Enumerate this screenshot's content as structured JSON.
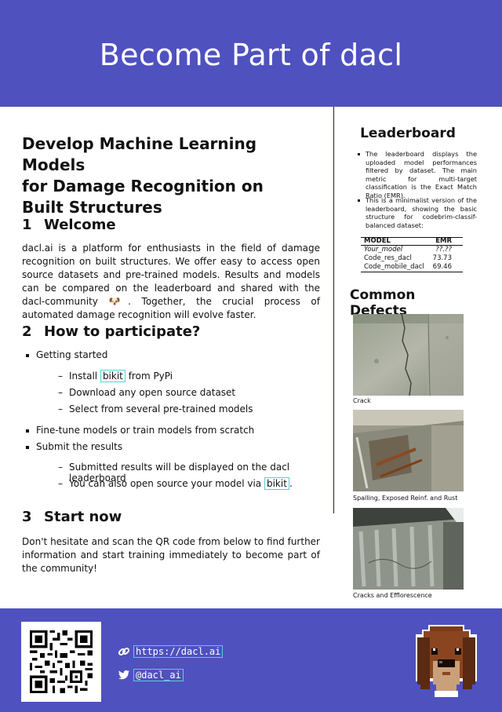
{
  "header": {
    "title": "Become Part of dacl"
  },
  "main": {
    "subtitle_lines": [
      "Develop Machine Learning Models",
      "for Damage Recognition on",
      "Built Structures"
    ],
    "sections": [
      {
        "num": "1",
        "title": "Welcome",
        "paragraph": "dacl.ai is a platform for enthusiasts in the field of damage recognition on built structures. We offer easy to access open source datasets and pre-trained models. Results and models can be compared on the leaderboard and shared with the dacl-community 🐶. Together, the crucial process of automated damage recognition will evolve faster."
      },
      {
        "num": "2",
        "title": "How to participate?",
        "items": [
          {
            "label": "Getting started"
          },
          {
            "label": "Fine-tune models or train models from scratch"
          },
          {
            "label": "Submit the results"
          }
        ],
        "getting_started": [
          {
            "prefix": "Install ",
            "link": "bikit",
            "suffix": " from PyPi"
          },
          {
            "text": "Download any open source dataset"
          },
          {
            "text": "Select from several pre-trained models"
          }
        ],
        "submit": [
          {
            "text": "Submitted results will be displayed on the dacl leaderboard"
          },
          {
            "prefix": "You can also open source your model via ",
            "link": "bikit",
            "suffix": "."
          }
        ]
      },
      {
        "num": "3",
        "title": "Start now",
        "paragraph": "Don't hesitate and scan the QR code from below to find further information and start training immediately to become part of the community!"
      }
    ]
  },
  "sidebar": {
    "leaderboard": {
      "title": "Leaderboard",
      "bullets": [
        "The leaderboard displays the uploaded model performances filtered by dataset. The main metric for multi-target classification is the Exact Match Ratio (EMR).",
        "This is a minimalist version of the leaderboard, showing the basic structure for codebrim-classif-balanced dataset:"
      ],
      "table": {
        "headers": [
          "MODEL",
          "EMR"
        ],
        "rows": [
          {
            "model": "Your_model",
            "emr": "??.??"
          },
          {
            "model": "Code_res_dacl",
            "emr": "73.73"
          },
          {
            "model": "Code_mobile_dacl",
            "emr": "69.46"
          }
        ]
      }
    },
    "defects": {
      "title": "Common Defects",
      "images": [
        {
          "caption": "Crack"
        },
        {
          "caption": "Spalling, Exposed Reinf. and Rust"
        },
        {
          "caption": "Cracks and Efflorescence"
        }
      ]
    }
  },
  "footer": {
    "website": {
      "text": "https://dacl.ai",
      "icon": "link-icon"
    },
    "twitter": {
      "text": "@dacl_ai",
      "icon": "twitter-icon"
    },
    "qr_icon": "qr-code",
    "mascot_icon": "dog-mascot-icon",
    "colors": {
      "brand": "#4f51bf",
      "link_border": "#4fd4d4"
    }
  }
}
